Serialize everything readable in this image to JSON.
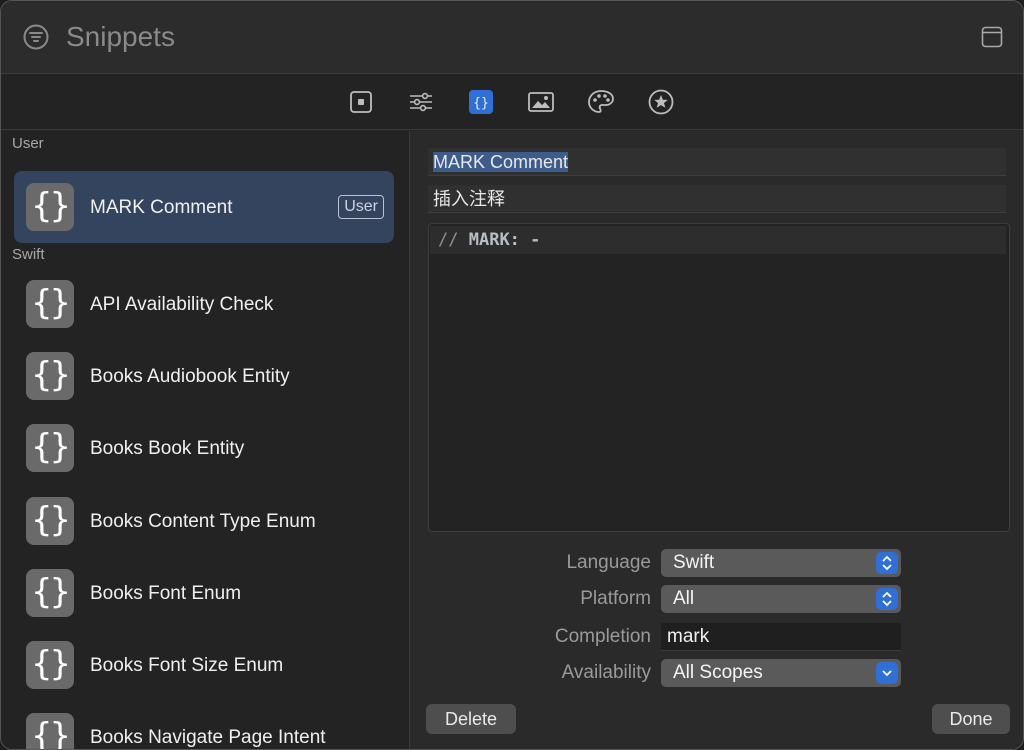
{
  "window": {
    "title": "Snippets"
  },
  "toolbar": {
    "buttons": [
      {
        "name": "file-templates-icon",
        "active": false
      },
      {
        "name": "sliders-icon",
        "active": false
      },
      {
        "name": "snippets-braces-icon",
        "active": true
      },
      {
        "name": "media-image-icon",
        "active": false
      },
      {
        "name": "color-palette-icon",
        "active": false
      },
      {
        "name": "star-circle-icon",
        "active": false
      }
    ]
  },
  "sidebar": {
    "groups": [
      {
        "header": "User",
        "items": [
          {
            "label": "MARK Comment",
            "badge": "User",
            "selected": true
          }
        ]
      },
      {
        "header": "Swift",
        "items": [
          {
            "label": "API Availability Check"
          },
          {
            "label": "Books Audiobook Entity"
          },
          {
            "label": "Books Book Entity"
          },
          {
            "label": "Books Content Type Enum"
          },
          {
            "label": "Books Font Enum"
          },
          {
            "label": "Books Font Size Enum"
          },
          {
            "label": "Books Navigate Page Intent"
          }
        ]
      }
    ],
    "icon_glyph": "{}"
  },
  "editor": {
    "title_value": "MARK Comment",
    "summary_value": "插入注释",
    "code": {
      "comment": "//",
      "text": "MARK: -"
    },
    "properties": {
      "language_label": "Language",
      "language_value": "Swift",
      "platform_label": "Platform",
      "platform_value": "All",
      "completion_label": "Completion",
      "completion_value": "mark",
      "availability_label": "Availability",
      "availability_value": "All Scopes"
    },
    "delete_label": "Delete",
    "done_label": "Done"
  },
  "colors": {
    "accent": "#2f6fd6",
    "selection": "#34445e"
  }
}
